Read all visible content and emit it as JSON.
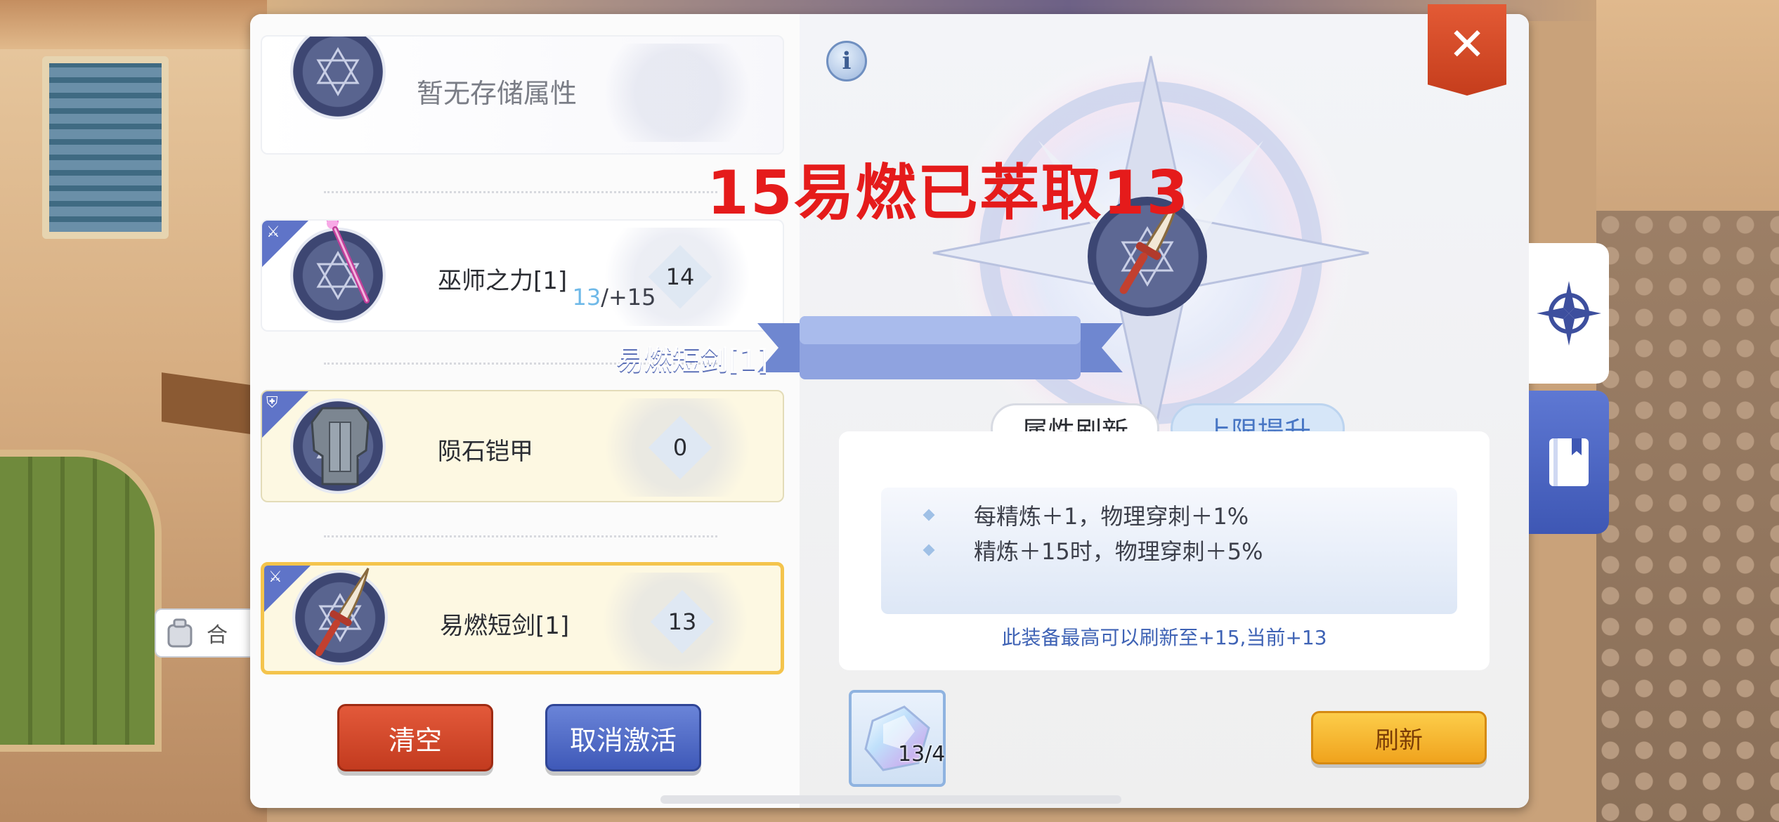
{
  "overlay": {
    "caption": "15易燃已萃取13"
  },
  "storage": {
    "empty_text": "暂无存储属性"
  },
  "equipment": [
    {
      "name": "巫师之力[1]",
      "level": "14",
      "type": "weapon"
    },
    {
      "name": "陨石铠甲",
      "level": "0",
      "type": "armor"
    },
    {
      "name": "易燃短剑[1]",
      "level": "13",
      "type": "weapon",
      "selected": true
    }
  ],
  "left_buttons": {
    "clear": "清空",
    "deactivate": "取消激活"
  },
  "detail": {
    "refine_current": "13",
    "refine_max": "/+15",
    "item_name": "易燃短剑[1]",
    "tabs": {
      "refresh": "属性刷新",
      "upgrade": "上限提升"
    },
    "effects": [
      "每精炼＋1，物理穿刺＋1%",
      "精炼＋15时，物理穿刺＋5%"
    ],
    "note": "此装备最高可以刷新至+15,当前+13",
    "material_count": "13/4",
    "refresh_button": "刷新"
  },
  "partial_chip": {
    "text": "合"
  },
  "colors": {
    "overlay_red": "#e51b1b",
    "accent_blue": "#3f59b8",
    "clear_red": "#c33b1f",
    "refresh_yellow": "#f0a31d",
    "selected_border": "#f4c44c"
  },
  "icons": {
    "info": "info-icon",
    "close": "close-icon",
    "side_tab_1": "compass-icon",
    "side_tab_2": "book-icon"
  }
}
